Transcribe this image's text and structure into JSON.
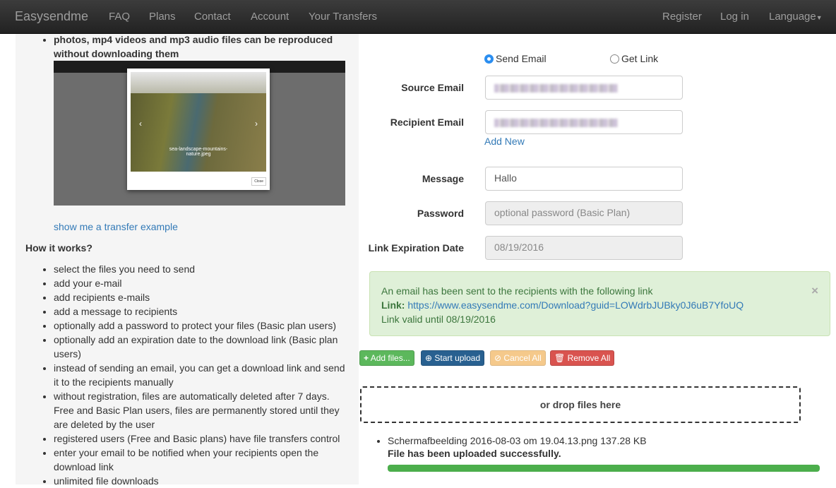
{
  "nav": {
    "brand": "Easysendme",
    "items": [
      "FAQ",
      "Plans",
      "Contact",
      "Account",
      "Your Transfers"
    ],
    "right": [
      "Register",
      "Log in",
      "Language"
    ]
  },
  "left": {
    "feature": "photos, mp4 videos and mp3 audio files can be reproduced without downloading them",
    "screenshot_caption": "sea-landscape-mountains-nature.jpeg",
    "example_link": "show me a transfer example",
    "how_title": "How it works?",
    "steps": [
      "select the files you need to send",
      "add your e-mail",
      "add recipients e-mails",
      "add a message to recipients",
      "optionally add a password to protect your files (Basic plan users)",
      "optionally add an expiration date to the download link (Basic plan users)",
      "instead of sending an email, you can get a download link and send it to the recipients manually",
      "without registration, files are automatically deleted after 7 days. Free and Basic Plan users, files are permanently stored until they are deleted by the user",
      "registered users (Free and Basic plans) have file transfers control",
      "enter your email to be notified when your recipients open the download link",
      "unlimited file downloads"
    ]
  },
  "form": {
    "mode_options": [
      "Send Email",
      "Get Link"
    ],
    "mode_selected": "Send Email",
    "source_label": "Source Email",
    "recipient_label": "Recipient Email",
    "add_new": "Add New",
    "message_label": "Message",
    "message_value": "Hallo",
    "password_label": "Password",
    "password_placeholder": "optional password (Basic Plan)",
    "expiry_label": "Link Expiration Date",
    "expiry_value": "08/19/2016"
  },
  "alert": {
    "line1": "An email has been sent to the recipients with the following link",
    "link_label": "Link:",
    "link": "https://www.easysendme.com/Download?guid=LOWdrbJUBky0J6uB7YfoUQ",
    "line3": "Link valid until 08/19/2016",
    "close": "×"
  },
  "buttons": {
    "add": "Add files...",
    "start": "Start upload",
    "cancel": "Cancel All",
    "remove": "Remove All"
  },
  "colors": {
    "add": "#5cb85c",
    "start": "#337ab7",
    "cancel": "#f0ad4e",
    "remove": "#d9534f"
  },
  "drop": "or drop files here",
  "upload": {
    "file": "Schermafbeelding 2016-08-03 om 19.04.13.png 137.28 KB",
    "status": "File has been uploaded successfully.",
    "progress_percent": 100
  }
}
